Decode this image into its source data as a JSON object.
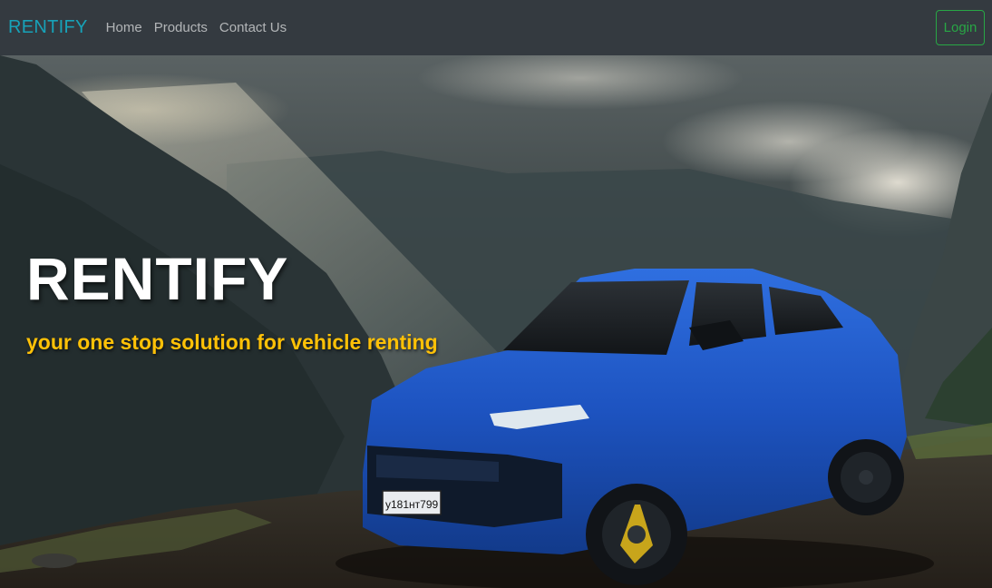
{
  "navbar": {
    "brand": "RENTIFY",
    "links": [
      "Home",
      "Products",
      "Contact Us"
    ],
    "login_label": "Login"
  },
  "hero": {
    "title": "RENTIFY",
    "tagline": "your one stop solution for vehicle renting",
    "image_subject": "blue SUV parked on mountain dirt road under cloudy sky"
  },
  "colors": {
    "navbar_bg": "#343a40",
    "brand": "#17a2b8",
    "login": "#28a745",
    "tagline": "#ffc107",
    "car": "#1f56c4"
  }
}
